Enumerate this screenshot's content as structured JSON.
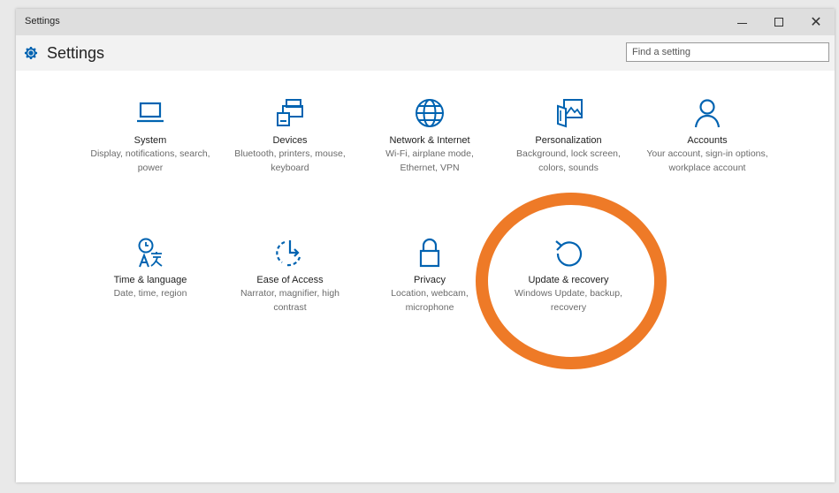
{
  "window": {
    "title": "Settings",
    "controls": {
      "minimize_icon": "minimize-icon",
      "maximize_icon": "maximize-icon",
      "close_icon": "close-icon"
    }
  },
  "header": {
    "title": "Settings",
    "icon": "gear-icon",
    "search_placeholder": "Find a setting"
  },
  "colors": {
    "accent": "#0063b1",
    "highlight_ring": "#ee7a27"
  },
  "tiles": [
    {
      "label": "System",
      "description": "Display, notifications, search, power",
      "icon": "laptop-icon"
    },
    {
      "label": "Devices",
      "description": "Bluetooth, printers, mouse, keyboard",
      "icon": "devices-icon"
    },
    {
      "label": "Network & Internet",
      "description": "Wi-Fi, airplane mode, Ethernet, VPN",
      "icon": "globe-icon"
    },
    {
      "label": "Personalization",
      "description": "Background, lock screen, colors, sounds",
      "icon": "personalization-icon"
    },
    {
      "label": "Accounts",
      "description": "Your account, sign-in options, workplace account",
      "icon": "person-icon"
    },
    {
      "label": "Time & language",
      "description": "Date, time, region",
      "icon": "time-language-icon"
    },
    {
      "label": "Ease of Access",
      "description": "Narrator, magnifier, high contrast",
      "icon": "ease-of-access-icon"
    },
    {
      "label": "Privacy",
      "description": "Location, webcam, microphone",
      "icon": "lock-icon"
    },
    {
      "label": "Update & recovery",
      "description": "Windows Update, backup, recovery",
      "icon": "refresh-icon"
    }
  ]
}
